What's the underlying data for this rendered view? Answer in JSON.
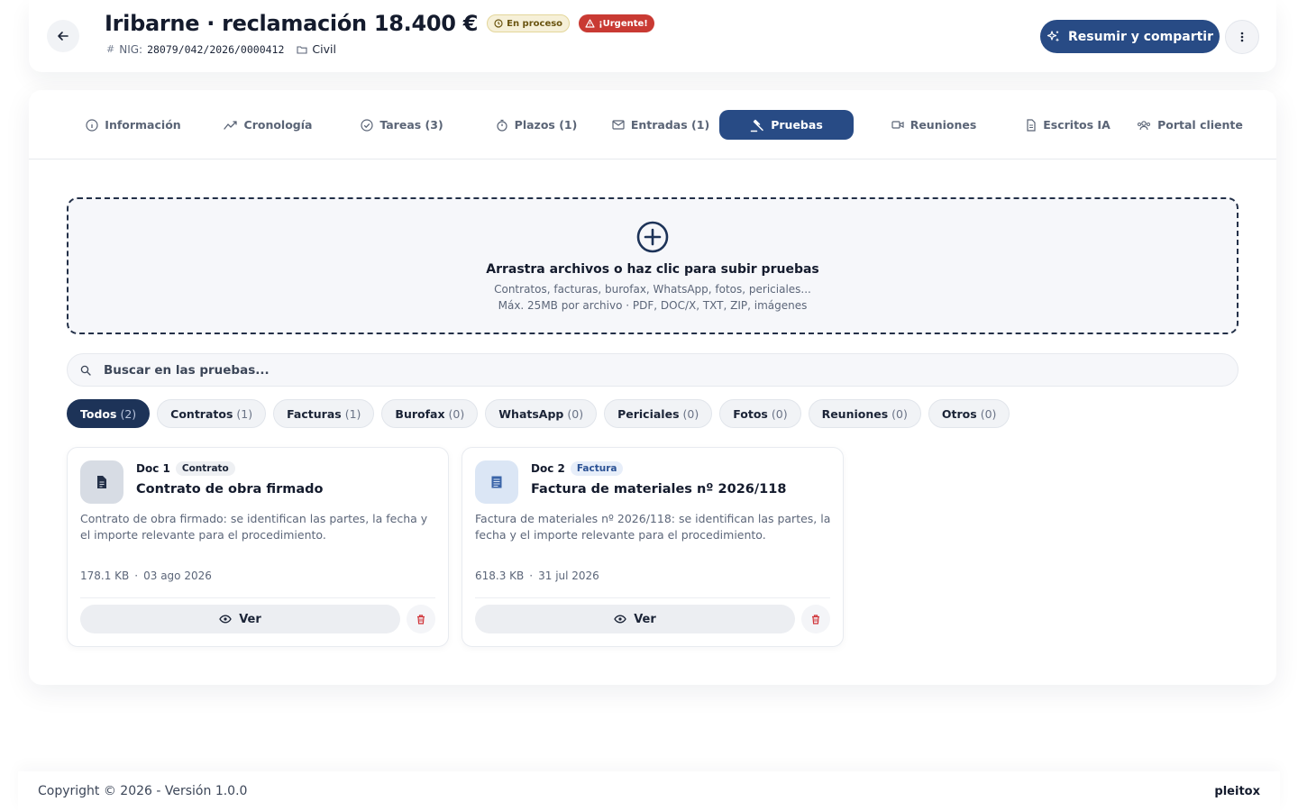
{
  "header": {
    "title": "Iribarne · reclamación 18.400 €",
    "status_badge": "En proceso",
    "urgent_badge": "¡Urgente!",
    "nig_label": "NIG:",
    "nig_value": "28079/042/2026/0000412",
    "jurisdiction": "Civil",
    "primary_action": "Resumir y compartir"
  },
  "tabs": [
    {
      "label": "Información",
      "icon": "info-icon"
    },
    {
      "label": "Cronología",
      "icon": "trend-icon"
    },
    {
      "label": "Tareas (3)",
      "icon": "check-circle-icon"
    },
    {
      "label": "Plazos (1)",
      "icon": "stopwatch-icon"
    },
    {
      "label": "Entradas (1)",
      "icon": "mail-icon"
    },
    {
      "label": "Pruebas",
      "icon": "gavel-icon",
      "active": true
    },
    {
      "label": "Reuniones",
      "icon": "video-icon"
    },
    {
      "label": "Escritos IA",
      "icon": "document-icon"
    },
    {
      "label": "Portal cliente",
      "icon": "users-icon"
    }
  ],
  "upload": {
    "title": "Arrastra archivos o haz clic para subir pruebas",
    "subtitle": "Contratos, facturas, burofax, WhatsApp, fotos, periciales...",
    "limits": "Máx. 25MB por archivo · PDF, DOC/X, TXT, ZIP, imágenes"
  },
  "search": {
    "placeholder": "Buscar en las pruebas..."
  },
  "filters": [
    {
      "label": "Todos",
      "count": "(2)",
      "active": true
    },
    {
      "label": "Contratos",
      "count": "(1)"
    },
    {
      "label": "Facturas",
      "count": "(1)"
    },
    {
      "label": "Burofax",
      "count": "(0)"
    },
    {
      "label": "WhatsApp",
      "count": "(0)"
    },
    {
      "label": "Periciales",
      "count": "(0)"
    },
    {
      "label": "Fotos",
      "count": "(0)"
    },
    {
      "label": "Reuniones",
      "count": "(0)"
    },
    {
      "label": "Otros",
      "count": "(0)"
    }
  ],
  "documents": [
    {
      "num": "Doc 1",
      "type": "Contrato",
      "title": "Contrato de obra firmado",
      "description": "Contrato de obra firmado: se identifican las partes, la fecha y el importe relevante para el procedimiento.",
      "size": "178.1 KB",
      "dot": "·",
      "date": "03 ago 2026",
      "view_label": "Ver"
    },
    {
      "num": "Doc 2",
      "type": "Factura",
      "title": "Factura de materiales nº 2026/118",
      "description": "Factura de materiales nº 2026/118: se identifican las partes, la fecha y el importe relevante para el procedimiento.",
      "size": "618.3 KB",
      "dot": "·",
      "date": "31 jul 2026",
      "view_label": "Ver"
    }
  ],
  "footer": {
    "copyright": "Copyright © 2026 - Versión 1.0.0",
    "brand": "pleitox"
  },
  "colors": {
    "primary": "#284b85",
    "primary_dark": "#1d3358",
    "urgent": "#c93a33",
    "status_bg": "#f6f0d8",
    "delete": "#d0353a"
  }
}
